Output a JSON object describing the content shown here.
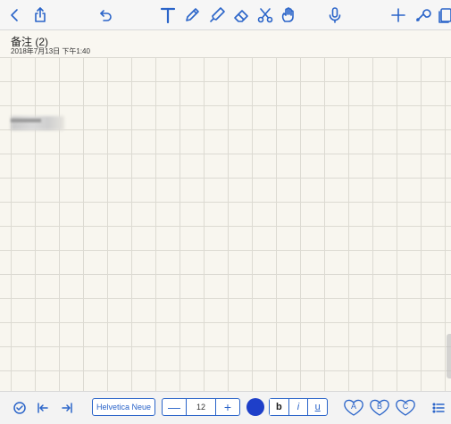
{
  "toolbar": {
    "icons": [
      "back-icon",
      "share-icon",
      "undo-icon",
      "text-tool-icon",
      "pencil-icon",
      "highlighter-icon",
      "eraser-icon",
      "scissors-icon",
      "hand-icon",
      "microphone-icon",
      "add-icon",
      "wrench-icon",
      "pages-icon"
    ]
  },
  "note": {
    "title": "备注 (2)",
    "date": "2018年7月13日 下午1:40"
  },
  "bottom": {
    "font_name": "Helvetica Neue",
    "minus_label": "—",
    "font_size": "12",
    "plus_label": "+",
    "bold_label": "b",
    "italic_label": "i",
    "underline_label": "u",
    "presets": [
      "A",
      "B",
      "C"
    ]
  },
  "colors": {
    "accent": "#2a64c9",
    "text_color": "#1e3fc9",
    "paper": "#f8f6ef"
  }
}
